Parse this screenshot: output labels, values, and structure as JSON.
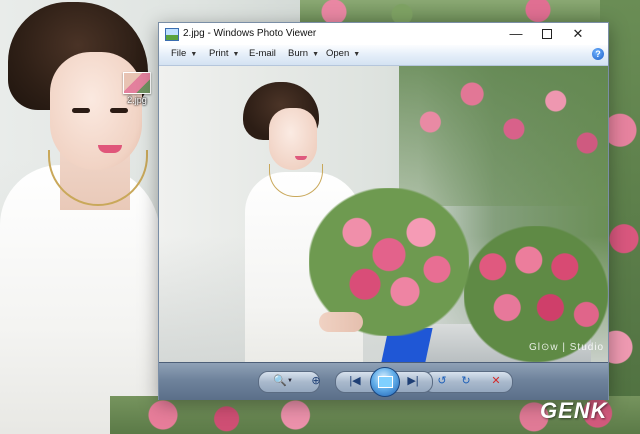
{
  "desktop": {
    "icon_label": "2.jpg"
  },
  "window": {
    "title": "2.jpg - Windows Photo Viewer",
    "minimize_glyph": "—",
    "close_glyph": "✕"
  },
  "menu": {
    "items": [
      {
        "label": "File",
        "has_dropdown": true
      },
      {
        "label": "Print",
        "has_dropdown": true
      },
      {
        "label": "E-mail",
        "has_dropdown": false
      },
      {
        "label": "Burn",
        "has_dropdown": true
      },
      {
        "label": "Open",
        "has_dropdown": true
      }
    ],
    "help_glyph": "?"
  },
  "photo": {
    "watermark": "Gl⊙w | Studio"
  },
  "toolbar": {
    "zoom_icon": "🔍",
    "zoom_caret": "▼",
    "fit_icon": "⊕",
    "prev_icon": "|◀",
    "next_icon": "▶|",
    "rotate_left_icon": "↺",
    "rotate_right_icon": "↻",
    "delete_icon": "✕"
  },
  "logo": {
    "text": "GENK"
  },
  "colors": {
    "toolbar_gradient": "#6f839c",
    "menubar": "#e3edf8",
    "delete": "#d42a2a",
    "logo_accent": "#e23b2a"
  }
}
